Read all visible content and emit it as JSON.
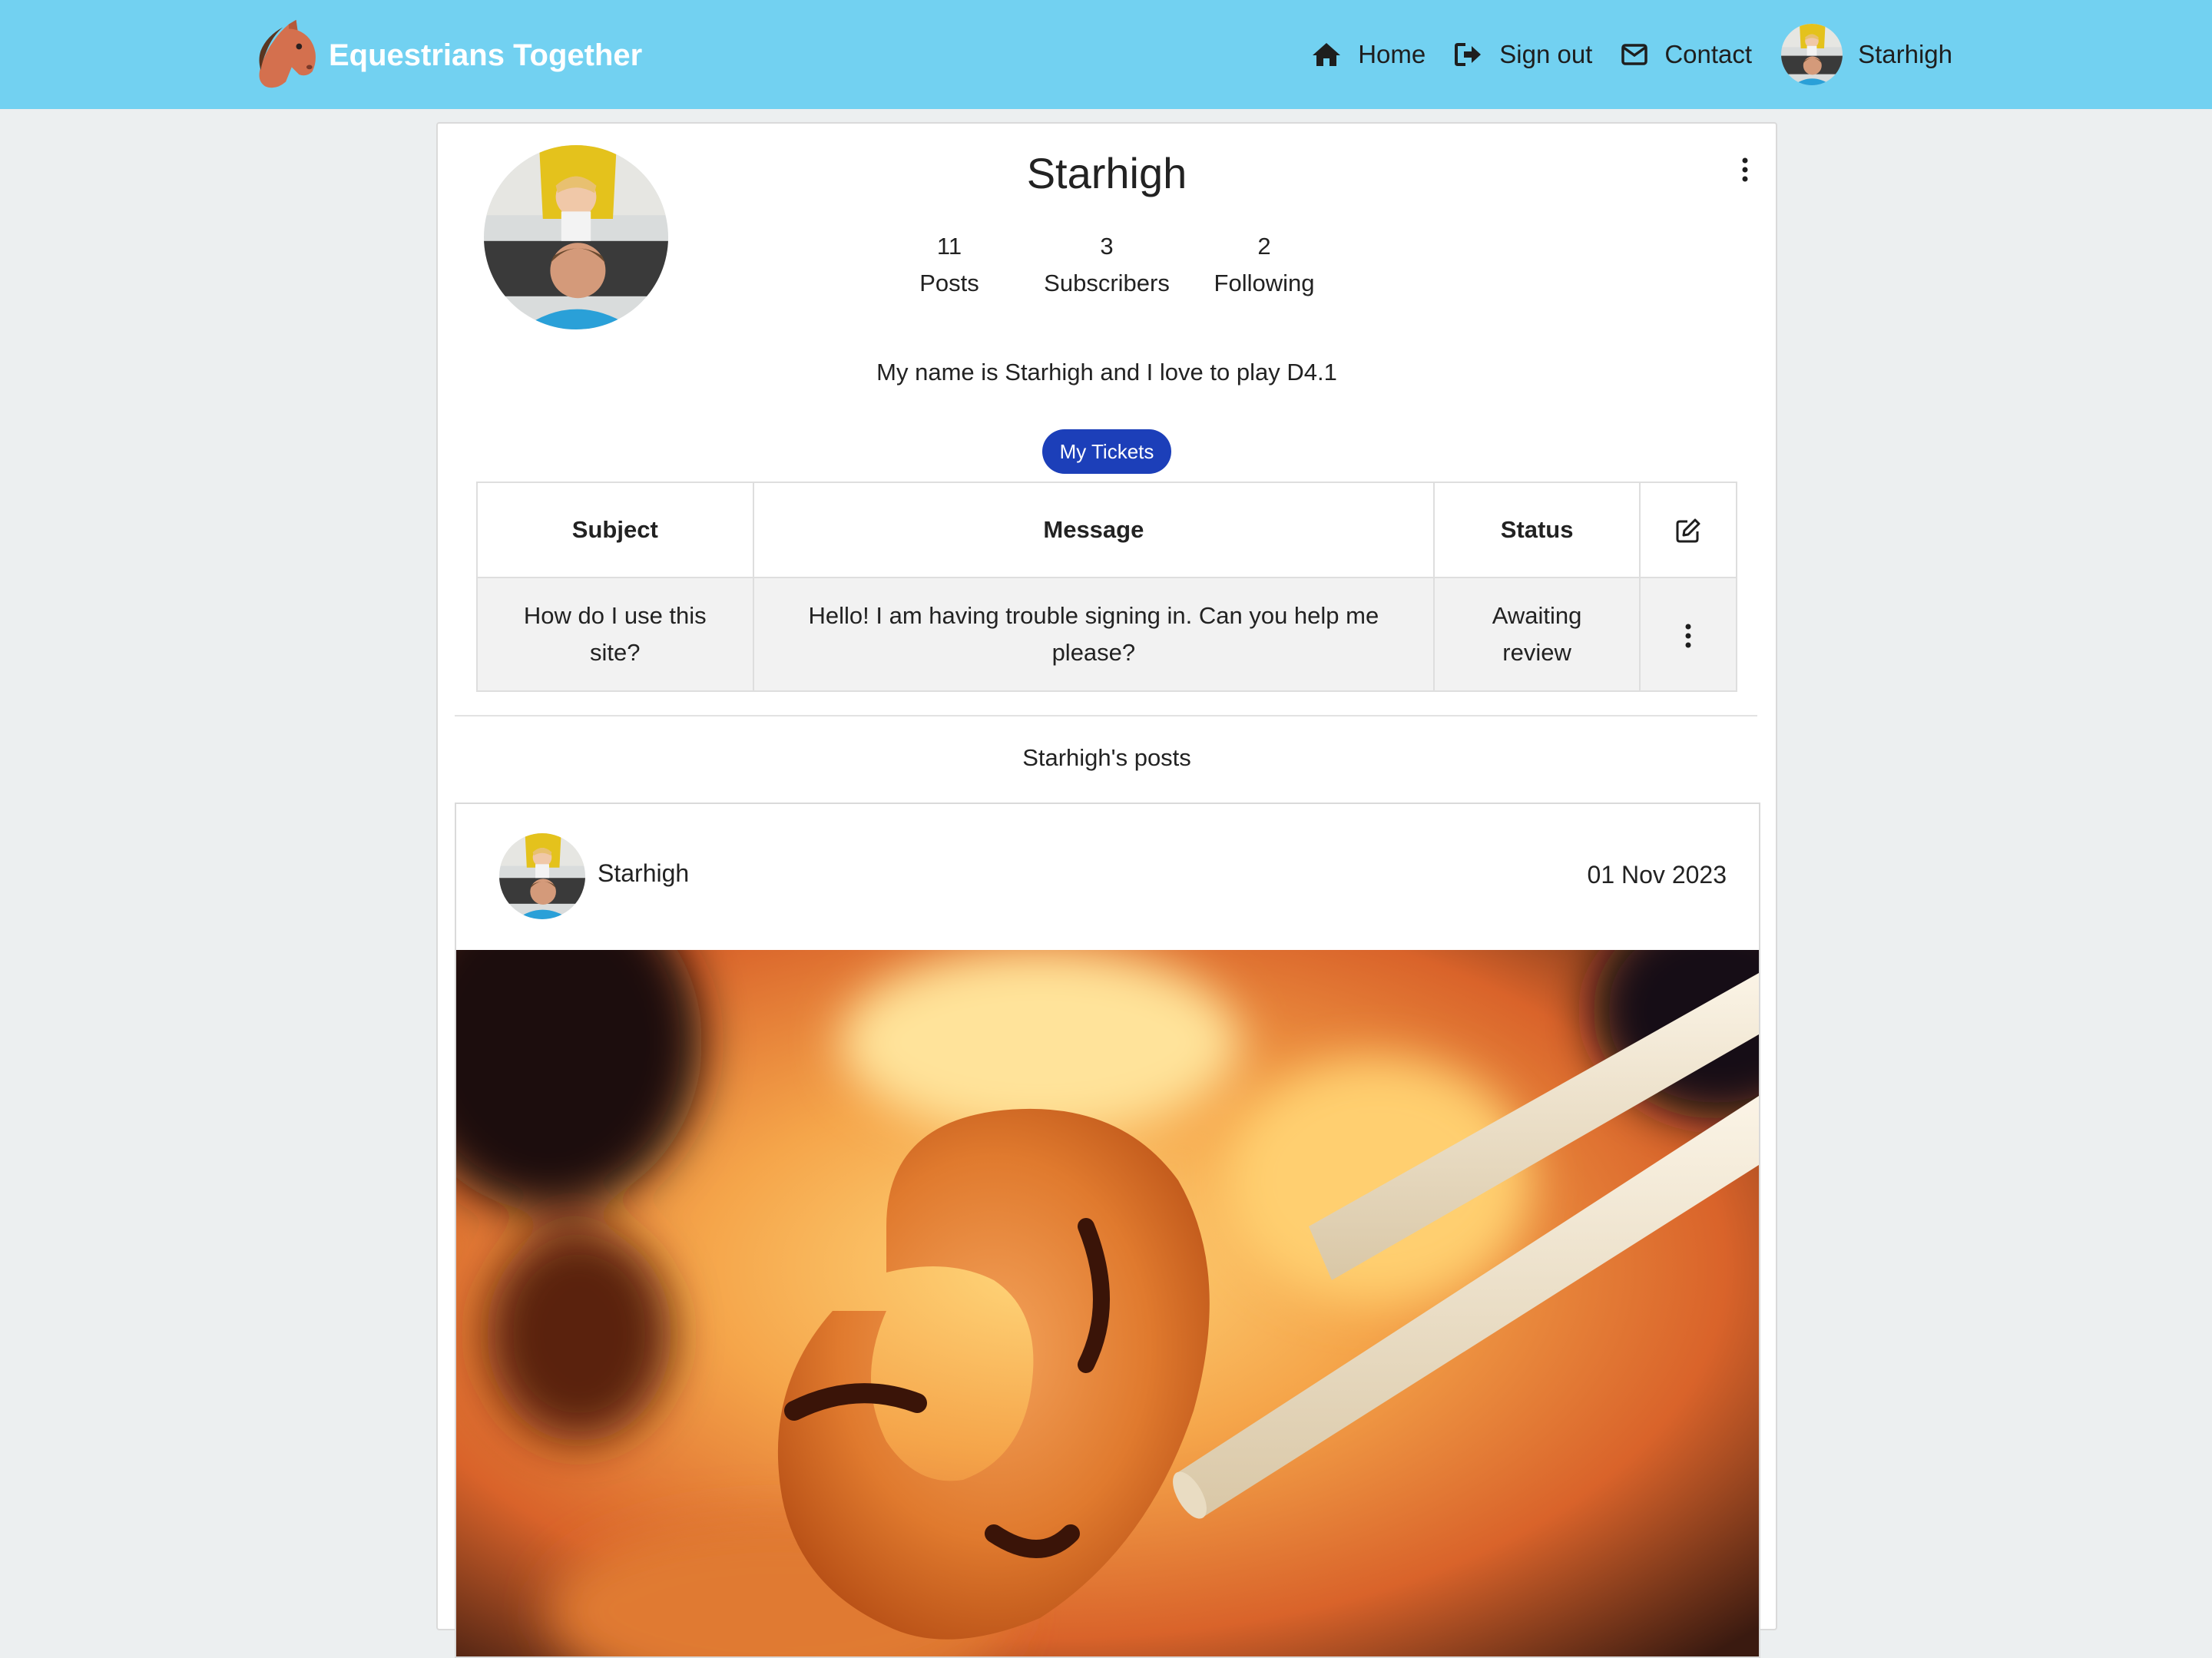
{
  "navbar": {
    "brand": "Equestrians Together",
    "links": {
      "home": "Home",
      "signout": "Sign out",
      "contact": "Contact",
      "profile": "Starhigh"
    },
    "bg_color": "#72d1f1"
  },
  "profile": {
    "name": "Starhigh",
    "stats": {
      "posts_count": "11",
      "posts_label": "Posts",
      "subscribers_count": "3",
      "subscribers_label": "Subscribers",
      "following_count": "2",
      "following_label": "Following"
    },
    "bio": "My name is Starhigh and I love to play D4.1",
    "tickets_button": "My Tickets"
  },
  "tickets": {
    "headers": {
      "subject": "Subject",
      "message": "Message",
      "status": "Status"
    },
    "rows": [
      {
        "subject": "How do I use this site?",
        "message": "Hello! I am having trouble signing in. Can you help me please?",
        "status": "Awaiting review"
      }
    ]
  },
  "posts": {
    "heading": "Starhigh's posts",
    "items": [
      {
        "author": "Starhigh",
        "date": "01 Nov 2023"
      }
    ]
  },
  "colors": {
    "accent_button": "#1c3fb9",
    "page_bg": "#eceff0"
  }
}
